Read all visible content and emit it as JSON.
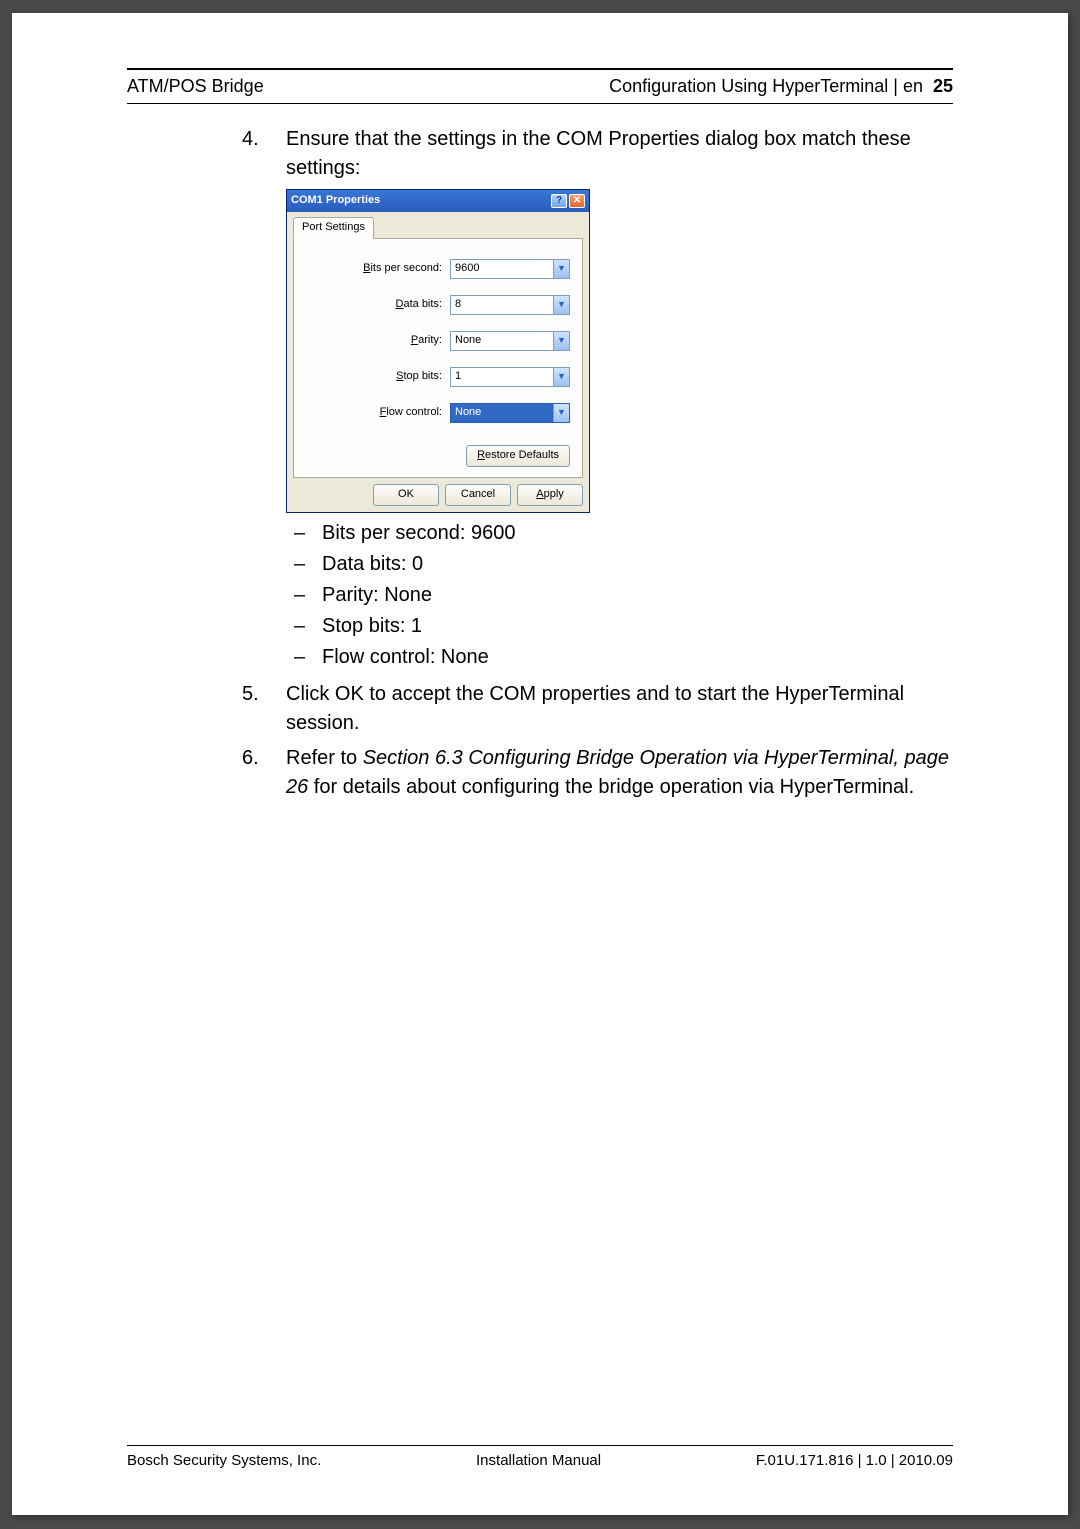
{
  "header": {
    "left": "ATM/POS Bridge",
    "right_text": "Configuration Using HyperTerminal | en",
    "page_num": "25"
  },
  "steps": {
    "s4": {
      "num": "4.",
      "text": "Ensure that the settings in the COM Properties dialog box match these settings:"
    },
    "s5": {
      "num": "5.",
      "text": "Click OK to accept the COM properties and to start the HyperTerminal session."
    },
    "s6": {
      "num": "6.",
      "pre": "Refer to ",
      "ref": "Section 6.3 Configuring Bridge Operation via HyperTerminal, page 26",
      "post": " for details about configuring the bridge operation via HyperTerminal."
    }
  },
  "sublist": {
    "a": "Bits per second: 9600",
    "b": "Data bits: 0",
    "c": "Parity: None",
    "d": "Stop bits: 1",
    "e": "Flow control: None"
  },
  "dialog": {
    "title": "COM1 Properties",
    "tab": "Port Settings",
    "rows": {
      "bps": {
        "pre": "B",
        "post": "its per second:",
        "value": "9600"
      },
      "data": {
        "pre": "D",
        "post": "ata bits:",
        "value": "8"
      },
      "parity": {
        "pre": "P",
        "post": "arity:",
        "value": "None"
      },
      "stop": {
        "pre": "S",
        "post": "top bits:",
        "value": "1"
      },
      "flow": {
        "pre": "F",
        "post": "low control:",
        "value": "None"
      }
    },
    "restore_pre": "R",
    "restore_post": "estore Defaults",
    "ok": "OK",
    "cancel": "Cancel",
    "apply_pre": "A",
    "apply_post": "pply"
  },
  "footer": {
    "left": "Bosch Security Systems, Inc.",
    "center": "Installation Manual",
    "right": "F.01U.171.816 | 1.0 | 2010.09"
  }
}
